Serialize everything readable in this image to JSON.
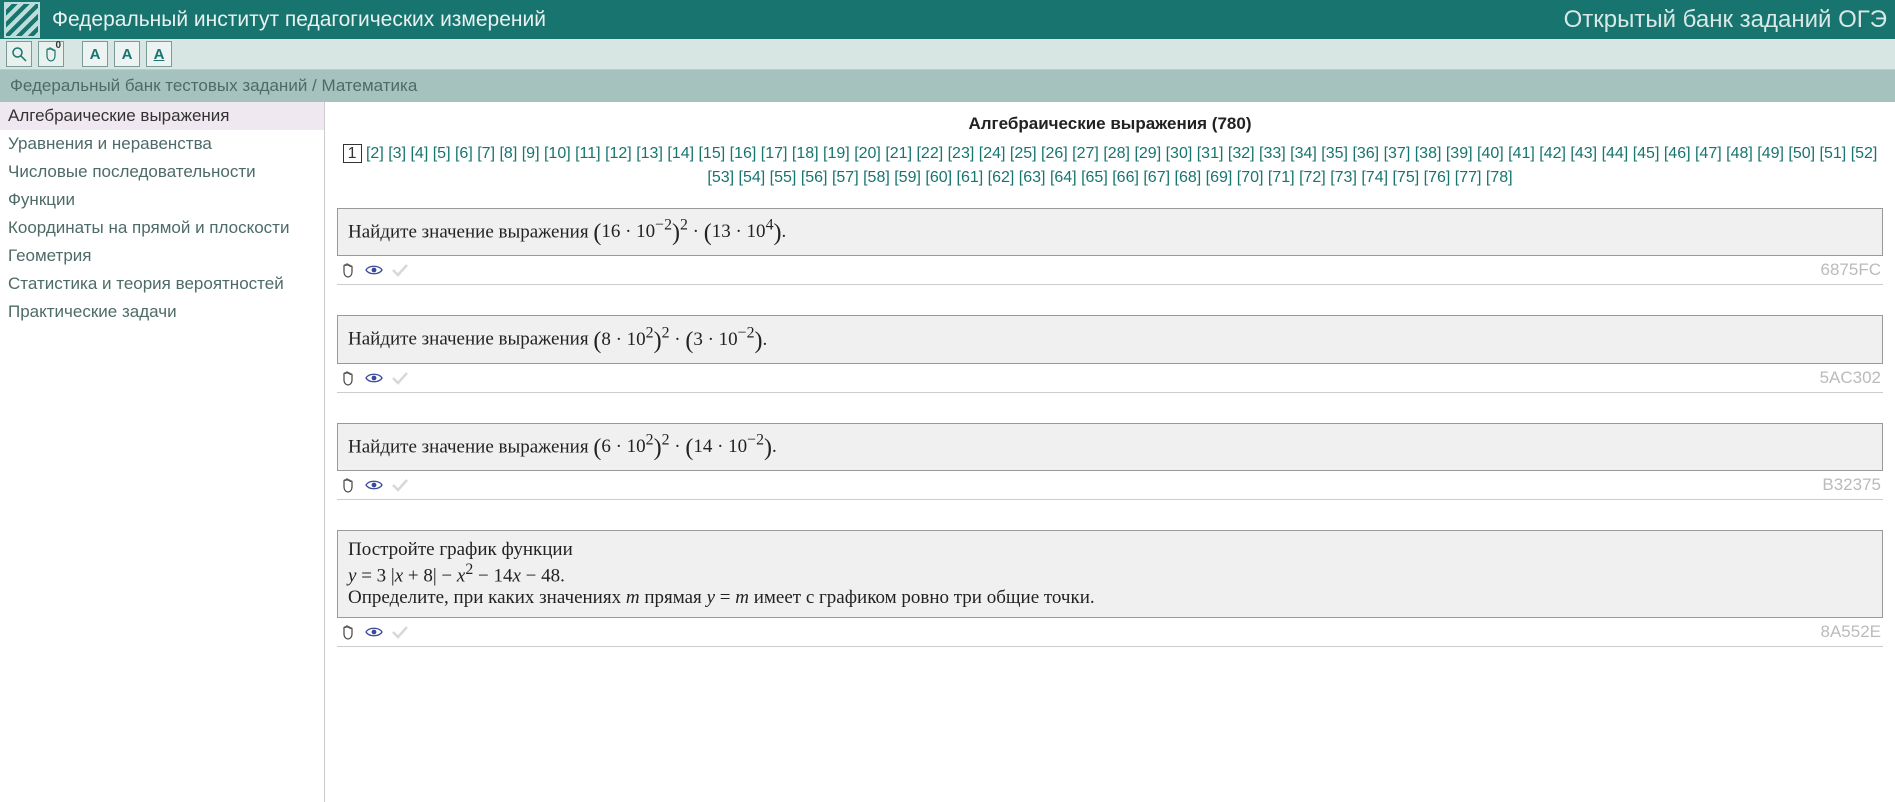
{
  "header": {
    "title": "Федеральный институт педагогических измерений",
    "subtitle": "Открытый банк заданий ОГЭ"
  },
  "toolbar": {
    "search": "search",
    "hand": "hand",
    "hand_badge": "0",
    "fontA": "A",
    "fontB": "A",
    "fontC": "A"
  },
  "breadcrumb": "Федеральный банк тестовых заданий / Математика",
  "sidebar": {
    "items": [
      "Алгебраические выражения",
      "Уравнения и неравенства",
      "Числовые последовательности",
      "Функции",
      "Координаты на прямой и плоскости",
      "Геометрия",
      "Статистика и теория вероятностей",
      "Практические задачи"
    ],
    "active_index": 0
  },
  "page_title": "Алгебраические выражения (780)",
  "pagination": {
    "total": 78,
    "current": 1
  },
  "tasks": [
    {
      "prefix": "Найдите значение выражения ",
      "formula_html": "<span class='paren'>(</span>16 · 10<sup>−2</sup><span class='paren'>)</span><sup>2</sup> · <span class='paren'>(</span>13 · 10<sup>4</sup><span class='paren'>)</span>.",
      "code": "6875FC"
    },
    {
      "prefix": "Найдите значение выражения ",
      "formula_html": "<span class='paren'>(</span>8 · 10<sup>2</sup><span class='paren'>)</span><sup>2</sup> · <span class='paren'>(</span>3 · 10<sup>−2</sup><span class='paren'>)</span>.",
      "code": "5AC302"
    },
    {
      "prefix": "Найдите значение выражения ",
      "formula_html": "<span class='paren'>(</span>6 · 10<sup>2</sup><span class='paren'>)</span><sup>2</sup> · <span class='paren'>(</span>14 · 10<sup>−2</sup><span class='paren'>)</span>.",
      "code": "B32375"
    },
    {
      "lines_html": [
        "Постройте график функции",
        "<span class='italic'>y</span> = 3 |<span class='italic'>x</span> + 8| − <span class='italic'>x</span><sup>2</sup> − 14<span class='italic'>x</span> − 48.",
        "Определите, при каких значениях <span class='italic'>m</span> прямая <span class='italic'>y</span> = <span class='italic'>m</span> имеет с графиком ровно три общие точки."
      ],
      "code": "8A552E"
    }
  ]
}
